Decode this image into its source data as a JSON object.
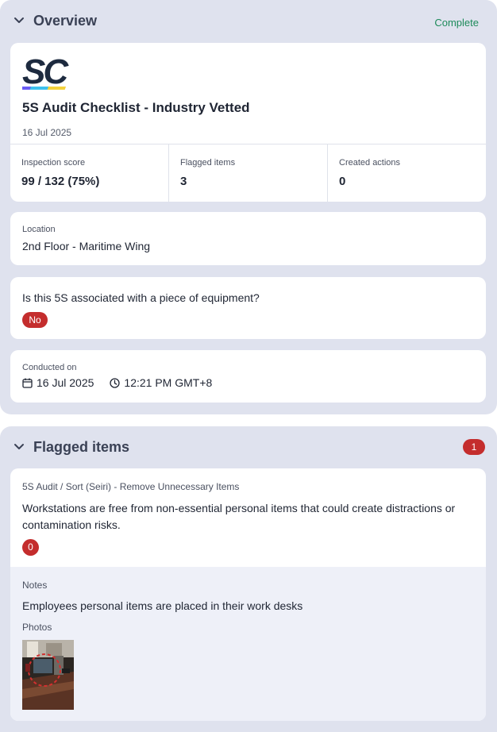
{
  "overview": {
    "title": "Overview",
    "status": "Complete",
    "template_title": "5S Audit Checklist - Industry Vetted",
    "date": "16 Jul 2025",
    "logo_text": "SC",
    "stats": [
      {
        "label": "Inspection score",
        "value": "99 / 132 (75%)"
      },
      {
        "label": "Flagged items",
        "value": "3"
      },
      {
        "label": "Created actions",
        "value": "0"
      }
    ],
    "location": {
      "label": "Location",
      "value": "2nd Floor - Maritime Wing"
    },
    "equipment": {
      "question": "Is this 5S associated with a piece of equipment?",
      "answer": "No"
    },
    "conducted": {
      "label": "Conducted on",
      "date": "16 Jul 2025",
      "time": "12:21 PM GMT+8"
    }
  },
  "flagged": {
    "title": "Flagged items",
    "count": "1",
    "item": {
      "path": "5S Audit / Sort (Seiri) - Remove Unnecessary Items",
      "question": "Workstations are free from non-essential personal items that could create distractions or contamination risks.",
      "badge": "0",
      "notes_label": "Notes",
      "notes": "Employees personal items are placed in their work desks",
      "photos_label": "Photos"
    }
  },
  "colors": {
    "section_bg": "#dfe2ee",
    "complete_green": "#1d8a5a",
    "flag_red": "#c42d2d",
    "logo_navy": "#1d2a3f"
  },
  "icons": [
    "chevron-down-icon",
    "calendar-icon",
    "clock-icon"
  ]
}
